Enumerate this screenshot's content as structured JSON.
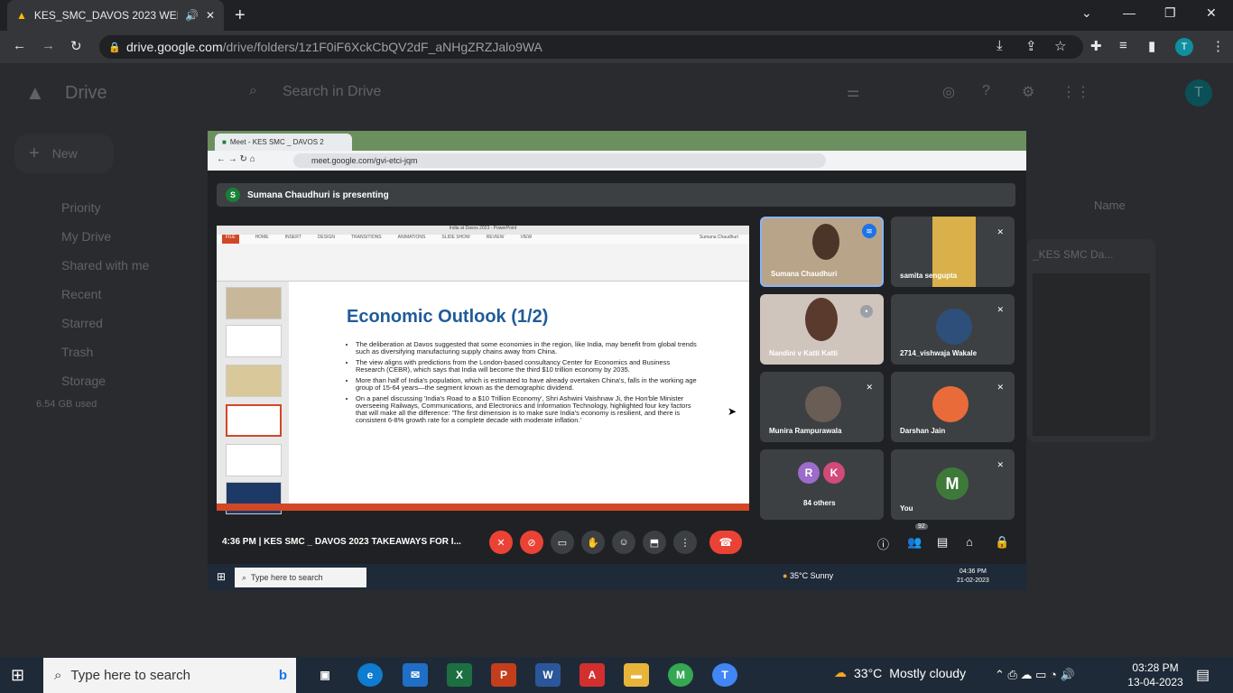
{
  "browser": {
    "tab_title": "KES_SMC_DAVOS 2023 WEB",
    "new_tab_icon": "+",
    "url_host": "drive.google.com",
    "url_path": "/drive/folders/1z1F0iF6XckCbQV2dF_aNHgZRZJalo9WA",
    "profile_initial": "T"
  },
  "drive": {
    "logo": "Drive",
    "search_placeholder": "Search in Drive",
    "new_button": "New",
    "nav": [
      "Priority",
      "My Drive",
      "Shared with me",
      "Recent",
      "Starred",
      "Trash",
      "Storage"
    ],
    "storage_used": "6.54 GB used",
    "sort_label": "Name",
    "file_name": "_KES SMC Da...",
    "profile_initial": "T"
  },
  "meet": {
    "tab_title": "Meet - KES SMC _ DAVOS 2",
    "url": "meet.google.com/gvi-etci-jqm",
    "presenting": "Sumana Chaudhuri is presenting",
    "presenter_initial": "S",
    "time": "4:36 PM",
    "meeting_title": "KES SMC _ DAVOS 2023 TAKEAWAYS FOR I...",
    "people_count": "92",
    "participants": [
      {
        "name": "Sumana Chaudhuri"
      },
      {
        "name": "samita sengupta"
      },
      {
        "name": "Nandini v Katti Katti"
      },
      {
        "name": "2714_vishwaja Wakale"
      },
      {
        "name": "Munira Rampurawala"
      },
      {
        "name": "Darshan Jain"
      },
      {
        "name": "84 others",
        "initials": [
          "R",
          "K"
        ]
      },
      {
        "name": "You",
        "initial": "M"
      }
    ],
    "taskbar_search": "Type here to search",
    "weather_temp": "35°C",
    "weather_text": "Sunny",
    "clock_time": "04:36 PM",
    "clock_date": "21-02-2023"
  },
  "ppt": {
    "window_title": "India at Davos 2023 - PowerPoint",
    "tabs": [
      "FILE",
      "HOME",
      "INSERT",
      "DESIGN",
      "TRANSITIONS",
      "ANIMATIONS",
      "SLIDE SHOW",
      "REVIEW",
      "VIEW"
    ],
    "user": "Sumana Chaudhuri",
    "slide_title": "Economic Outlook (1/2)",
    "bullets": [
      "The deliberation at Davos suggested that some economies in the region, like India, may benefit from global trends such as diversifying manufacturing supply chains away from China.",
      "The view aligns with predictions from the London-based consultancy Center for Economics and Business Research (CEBR), which says that India will become the third $10 trillion economy by 2035.",
      "More than half of India's population, which is estimated to have already overtaken China's, falls in the working age group of 15-64 years—the segment known as the demographic dividend.",
      "On a panel discussing 'India's Road to a $10 Trillion Economy', Shri Ashwini Vaishnaw Ji, the Hon'ble Minister overseeing Railways, Communications, and Electronics and Information Technology, highlighted four key factors that will make all the difference: 'The first dimension is to make sure India's economy is resilient, and there is consistent 6-8% growth rate for a complete decade with moderate inflation.'"
    ]
  },
  "taskbar": {
    "search_placeholder": "Type here to search",
    "temp": "33°C",
    "weather": "Mostly cloudy",
    "time": "03:28 PM",
    "date": "13-04-2023"
  }
}
